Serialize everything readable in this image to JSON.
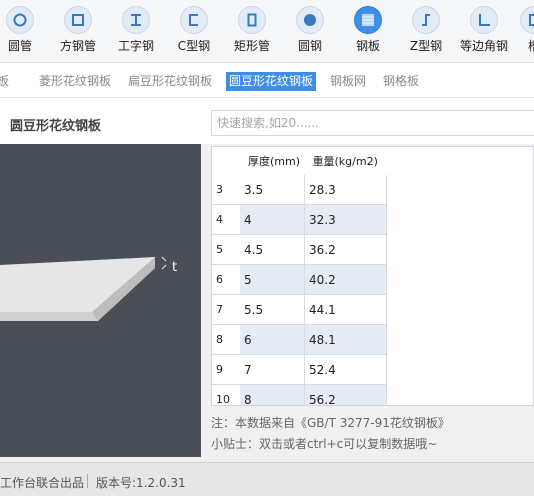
{
  "categories": [
    {
      "label": "圆管",
      "icon": "round-pipe-icon"
    },
    {
      "label": "方钢管",
      "icon": "square-pipe-icon"
    },
    {
      "label": "工字钢",
      "icon": "i-beam-icon"
    },
    {
      "label": "C型钢",
      "icon": "c-channel-icon"
    },
    {
      "label": "矩形管",
      "icon": "rect-pipe-icon"
    },
    {
      "label": "圆钢",
      "icon": "round-bar-icon"
    },
    {
      "label": "钢板",
      "icon": "steel-plate-icon"
    },
    {
      "label": "Z型钢",
      "icon": "z-section-icon"
    },
    {
      "label": "等边角钢",
      "icon": "angle-steel-icon"
    },
    {
      "label": "槽",
      "icon": "channel-icon"
    }
  ],
  "sub_tabs": [
    "钢板",
    "菱形花纹钢板",
    "扁豆形花纹钢板",
    "圆豆形花纹钢板",
    "钢板网",
    "钢格板"
  ],
  "page_title": "圆豆形花纹钢板",
  "search_placeholder": "快速搜索,如20......",
  "preview_label": "t",
  "table": {
    "headers": [
      "厚度(mm)",
      "重量(kg/m2)"
    ],
    "rows": [
      {
        "idx": "3",
        "c1": "3.5",
        "c2": "28.3"
      },
      {
        "idx": "4",
        "c1": "4",
        "c2": "32.3"
      },
      {
        "idx": "5",
        "c1": "4.5",
        "c2": "36.2"
      },
      {
        "idx": "6",
        "c1": "5",
        "c2": "40.2"
      },
      {
        "idx": "7",
        "c1": "5.5",
        "c2": "44.1"
      },
      {
        "idx": "8",
        "c1": "6",
        "c2": "48.1"
      },
      {
        "idx": "9",
        "c1": "7",
        "c2": "52.4"
      },
      {
        "idx": "10",
        "c1": "8",
        "c2": "56.2"
      }
    ]
  },
  "notes": {
    "source": "注：本数据来自《GB/T 3277-91花纹钢板》",
    "tip": "小贴士：双击或者ctrl+c可以复制数据哦~"
  },
  "status": {
    "publisher": "工作台联合出品",
    "version": "版本号:1.2.0.31"
  },
  "colors": {
    "accent": "#3e8ee6",
    "preview_bg": "#4a4f57"
  }
}
